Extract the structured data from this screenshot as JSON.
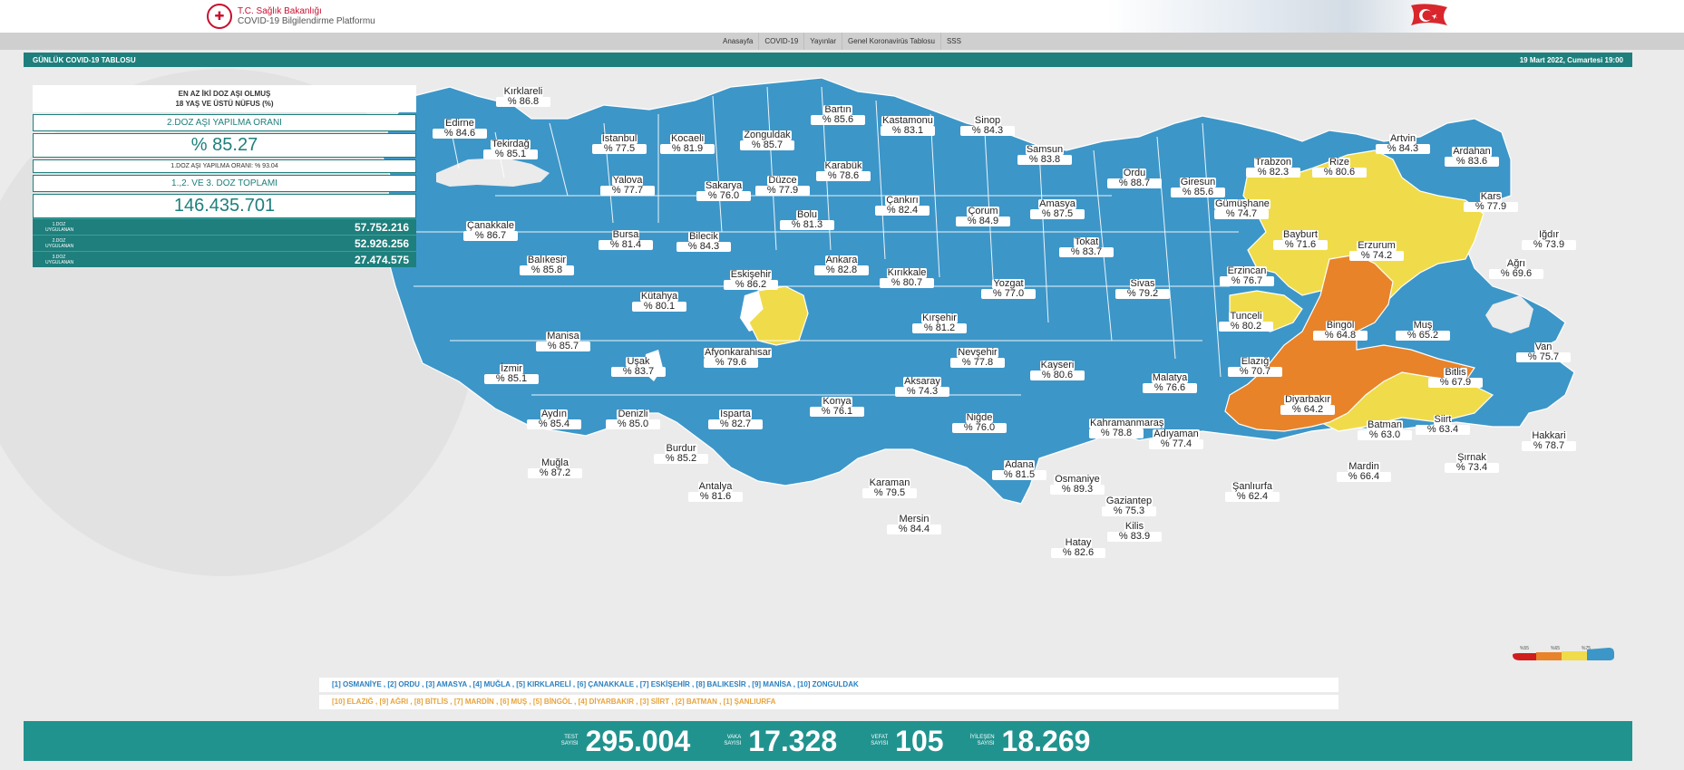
{
  "header": {
    "ministry": "T.C. Sağlık Bakanlığı",
    "platform": "COVID-19 Bilgilendirme Platformu"
  },
  "nav": [
    "Anasayfa",
    "COVID-19",
    "Yayınlar",
    "Genel Koronavirüs Tablosu",
    "SSS"
  ],
  "title": {
    "left": "GÜNLÜK COVID-19 TABLOSU",
    "right": "19 Mart 2022, Cumartesi 19:00"
  },
  "panel": {
    "heading1": "EN AZ İKİ DOZ AŞI OLMUŞ",
    "heading2": "18 YAŞ VE ÜSTÜ NÜFUS (%)",
    "dose2_label": "2.DOZ AŞI YAPILMA ORANI",
    "dose2_value": "% 85.27",
    "dose1_note": "1.DOZ AŞI YAPILMA ORANI: % 93.04",
    "total_label": "1.,2. VE 3. DOZ TOPLAMI",
    "total_value": "146.435.701",
    "doses": [
      {
        "label1": "1.DOZ",
        "label2": "UYGULANAN",
        "value": "57.752.216"
      },
      {
        "label1": "2.DOZ",
        "label2": "UYGULANAN",
        "value": "52.926.256"
      },
      {
        "label1": "3.DOZ",
        "label2": "UYGULANAN",
        "value": "27.474.575"
      }
    ]
  },
  "colors": {
    "blue": "#3d96c8",
    "yellow": "#f0dc4a",
    "orange": "#e8832a",
    "red": "#d01c1c",
    "teal": "#1e7f7c"
  },
  "cities": [
    {
      "name": "Edirne",
      "value": "% 84.6"
    },
    {
      "name": "Kırklareli",
      "value": "% 86.8"
    },
    {
      "name": "Tekirdağ",
      "value": "% 85.1"
    },
    {
      "name": "İstanbul",
      "value": "% 77.5"
    },
    {
      "name": "Kocaeli",
      "value": "% 81.9"
    },
    {
      "name": "Zonguldak",
      "value": "% 85.7"
    },
    {
      "name": "Bartın",
      "value": "% 85.6"
    },
    {
      "name": "Kastamonu",
      "value": "% 83.1"
    },
    {
      "name": "Sinop",
      "value": "% 84.3"
    },
    {
      "name": "Samsun",
      "value": "% 83.8"
    },
    {
      "name": "Ordu",
      "value": "% 88.7"
    },
    {
      "name": "Giresun",
      "value": "% 85.6"
    },
    {
      "name": "Trabzon",
      "value": "% 82.3"
    },
    {
      "name": "Rize",
      "value": "% 80.6"
    },
    {
      "name": "Artvin",
      "value": "% 84.3"
    },
    {
      "name": "Ardahan",
      "value": "% 83.6"
    },
    {
      "name": "Kars",
      "value": "% 77.9"
    },
    {
      "name": "Iğdır",
      "value": "% 73.9"
    },
    {
      "name": "Ağrı",
      "value": "% 69.6"
    },
    {
      "name": "Erzurum",
      "value": "% 74.2"
    },
    {
      "name": "Bayburt",
      "value": "% 71.6"
    },
    {
      "name": "Gümüşhane",
      "value": "% 74.7"
    },
    {
      "name": "Erzincan",
      "value": "% 76.7"
    },
    {
      "name": "Tunceli",
      "value": "% 80.2"
    },
    {
      "name": "Bingöl",
      "value": "% 64.8"
    },
    {
      "name": "Muş",
      "value": "% 65.2"
    },
    {
      "name": "Van",
      "value": "% 75.7"
    },
    {
      "name": "Bitlis",
      "value": "% 67.9"
    },
    {
      "name": "Elazığ",
      "value": "% 70.7"
    },
    {
      "name": "Diyarbakır",
      "value": "% 64.2"
    },
    {
      "name": "Batman",
      "value": "% 63.0"
    },
    {
      "name": "Siirt",
      "value": "% 63.4"
    },
    {
      "name": "Hakkari",
      "value": "% 78.7"
    },
    {
      "name": "Şırnak",
      "value": "% 73.4"
    },
    {
      "name": "Mardin",
      "value": "% 66.4"
    },
    {
      "name": "Şanlıurfa",
      "value": "% 62.4"
    },
    {
      "name": "Adıyaman",
      "value": "% 77.4"
    },
    {
      "name": "Malatya",
      "value": "% 76.6"
    },
    {
      "name": "Kahramanmaraş",
      "value": "% 78.8"
    },
    {
      "name": "Gaziantep",
      "value": "% 75.3"
    },
    {
      "name": "Kilis",
      "value": "% 83.9"
    },
    {
      "name": "Osmaniye",
      "value": "% 89.3"
    },
    {
      "name": "Hatay",
      "value": "% 82.6"
    },
    {
      "name": "Adana",
      "value": "% 81.5"
    },
    {
      "name": "Mersin",
      "value": "% 84.4"
    },
    {
      "name": "Karaman",
      "value": "% 79.5"
    },
    {
      "name": "Niğde",
      "value": "% 76.0"
    },
    {
      "name": "Kayseri",
      "value": "% 80.6"
    },
    {
      "name": "Sivas",
      "value": "% 79.2"
    },
    {
      "name": "Tokat",
      "value": "% 83.7"
    },
    {
      "name": "Amasya",
      "value": "% 87.5"
    },
    {
      "name": "Çorum",
      "value": "% 84.9"
    },
    {
      "name": "Yozgat",
      "value": "% 77.0"
    },
    {
      "name": "Kırıkkale",
      "value": "% 80.7"
    },
    {
      "name": "Kırşehir",
      "value": "% 81.2"
    },
    {
      "name": "Nevşehir",
      "value": "% 77.8"
    },
    {
      "name": "Aksaray",
      "value": "% 74.3"
    },
    {
      "name": "Konya",
      "value": "% 76.1"
    },
    {
      "name": "Ankara",
      "value": "% 82.8"
    },
    {
      "name": "Çankırı",
      "value": "% 82.4"
    },
    {
      "name": "Karabük",
      "value": "% 78.6"
    },
    {
      "name": "Düzce",
      "value": "% 77.9"
    },
    {
      "name": "Bolu",
      "value": "% 81.3"
    },
    {
      "name": "Sakarya",
      "value": "% 76.0"
    },
    {
      "name": "Yalova",
      "value": "% 77.7"
    },
    {
      "name": "Bursa",
      "value": "% 81.4"
    },
    {
      "name": "Bilecik",
      "value": "% 84.3"
    },
    {
      "name": "Eskişehir",
      "value": "% 86.2"
    },
    {
      "name": "Kütahya",
      "value": "% 80.1"
    },
    {
      "name": "Afyonkarahisar",
      "value": "% 79.6"
    },
    {
      "name": "Uşak",
      "value": "% 83.7"
    },
    {
      "name": "Manisa",
      "value": "% 85.7"
    },
    {
      "name": "Balıkesir",
      "value": "% 85.8"
    },
    {
      "name": "Çanakkale",
      "value": "% 86.7"
    },
    {
      "name": "İzmir",
      "value": "% 85.1"
    },
    {
      "name": "Aydın",
      "value": "% 85.4"
    },
    {
      "name": "Denizli",
      "value": "% 85.0"
    },
    {
      "name": "Muğla",
      "value": "% 87.2"
    },
    {
      "name": "Burdur",
      "value": "% 85.2"
    },
    {
      "name": "Isparta",
      "value": "% 82.7"
    },
    {
      "name": "Antalya",
      "value": "% 81.6"
    }
  ],
  "legend": [
    "%55",
    "%65",
    "%75"
  ],
  "top_list": "[1] OSMANİYE , [2] ORDU , [3] AMASYA , [4] MUĞLA , [5] KIRKLARELİ , [6] ÇANAKKALE , [7] ESKİŞEHİR , [8] BALIKESİR , [9] MANİSA , [10] ZONGULDAK",
  "bottom_list": "[10] ELAZIĞ , [9] AĞRI , [8] BİTLİS , [7] MARDİN , [6] MUŞ , [5] BİNGÖL , [4] DİYARBAKIR , [3] SİİRT , [2] BATMAN , [1] ŞANLIURFA",
  "stats": [
    {
      "label1": "TEST",
      "label2": "SAYISI",
      "value": "295.004"
    },
    {
      "label1": "VAKA",
      "label2": "SAYISI",
      "value": "17.328"
    },
    {
      "label1": "VEFAT",
      "label2": "SAYISI",
      "value": "105"
    },
    {
      "label1": "İYİLEŞEN",
      "label2": "SAYISI",
      "value": "18.269"
    }
  ]
}
